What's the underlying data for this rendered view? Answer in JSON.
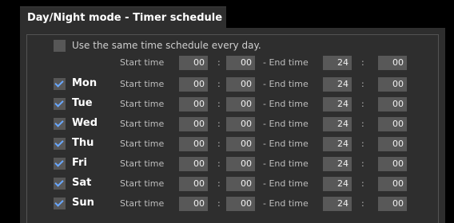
{
  "tab_title": "Day/Night mode - Timer schedule",
  "same_schedule_label": "Use the same time schedule every day.",
  "start_label": "Start time",
  "end_label": "- End time",
  "colon": ":",
  "header_row": {
    "start_h": "00",
    "start_m": "00",
    "end_h": "24",
    "end_m": "00"
  },
  "days": [
    {
      "label": "Mon",
      "checked": true,
      "start_h": "00",
      "start_m": "00",
      "end_h": "24",
      "end_m": "00"
    },
    {
      "label": "Tue",
      "checked": true,
      "start_h": "00",
      "start_m": "00",
      "end_h": "24",
      "end_m": "00"
    },
    {
      "label": "Wed",
      "checked": true,
      "start_h": "00",
      "start_m": "00",
      "end_h": "24",
      "end_m": "00"
    },
    {
      "label": "Thu",
      "checked": true,
      "start_h": "00",
      "start_m": "00",
      "end_h": "24",
      "end_m": "00"
    },
    {
      "label": "Fri",
      "checked": true,
      "start_h": "00",
      "start_m": "00",
      "end_h": "24",
      "end_m": "00"
    },
    {
      "label": "Sat",
      "checked": true,
      "start_h": "00",
      "start_m": "00",
      "end_h": "24",
      "end_m": "00"
    },
    {
      "label": "Sun",
      "checked": true,
      "start_h": "00",
      "start_m": "00",
      "end_h": "24",
      "end_m": "00"
    }
  ],
  "colors": {
    "background": "#000000",
    "panel": "#2e2e2e",
    "field": "#585858",
    "check_accent": "#6aa8ff"
  }
}
